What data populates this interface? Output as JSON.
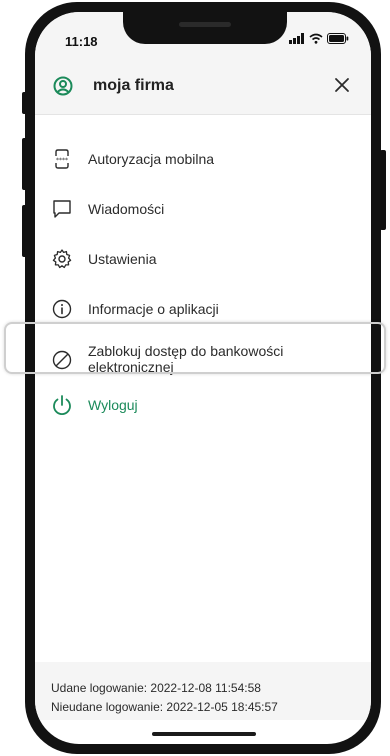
{
  "status": {
    "time": "11:18"
  },
  "header": {
    "company": "moja firma"
  },
  "menu": {
    "items": [
      {
        "label": "Autoryzacja mobilna",
        "icon": "mobile-authorization-icon"
      },
      {
        "label": "Wiadomości",
        "icon": "message-icon"
      },
      {
        "label": "Ustawienia",
        "icon": "gear-icon"
      },
      {
        "label": "Informacje o aplikacji",
        "icon": "info-icon"
      },
      {
        "label": "Zablokuj dostęp do bankowości elektronicznej",
        "icon": "block-icon"
      },
      {
        "label": "Wyloguj",
        "icon": "power-icon"
      }
    ]
  },
  "footer": {
    "last_login": "Udane logowanie: 2022-12-08 11:54:58",
    "failed_login": "Nieudane logowanie: 2022-12-05 18:45:57"
  },
  "colors": {
    "accent": "#1b8a5a",
    "header_bg": "#f5f5f5",
    "text": "#2b2b2b"
  }
}
